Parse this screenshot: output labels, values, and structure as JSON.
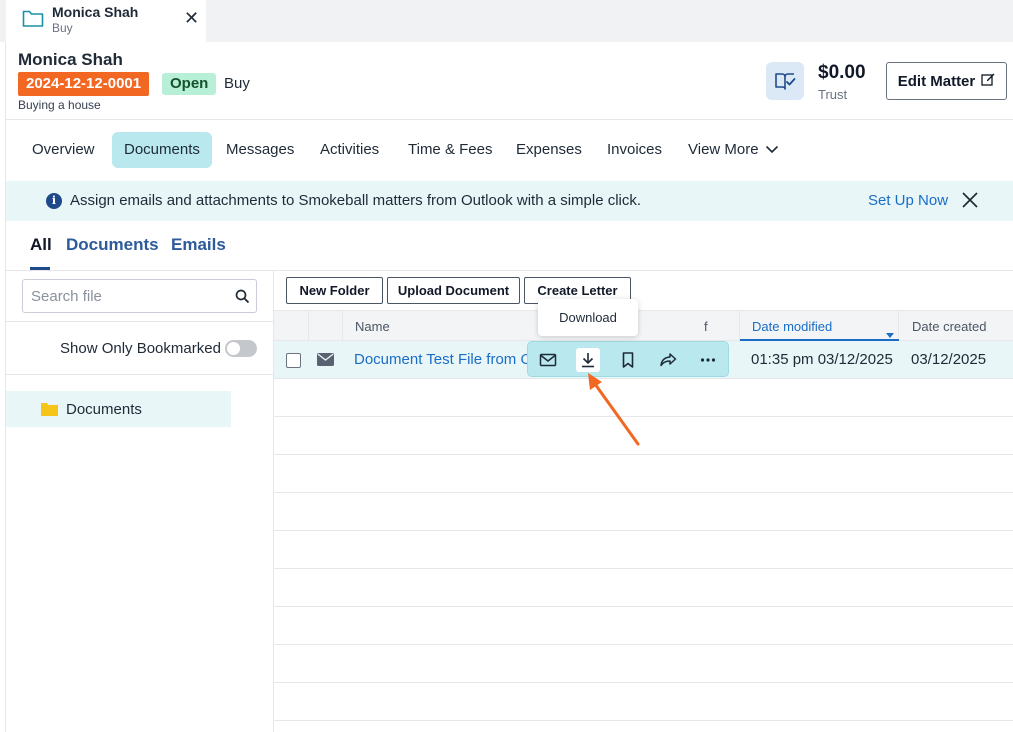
{
  "window_tab": {
    "title": "Monica Shah",
    "subtitle": "Buy",
    "close_glyph": "✕",
    "icon": "folder-icon"
  },
  "matter": {
    "client_name": "Monica Shah",
    "number": "2024-12-12-0001",
    "status": "Open",
    "type": "Buy",
    "description": "Buying a house",
    "trust_amount": "$0.00",
    "trust_label": "Trust",
    "edit_label": "Edit Matter"
  },
  "nav": {
    "tabs": [
      "Overview",
      "Documents",
      "Messages",
      "Activities",
      "Time & Fees",
      "Expenses",
      "Invoices",
      "View More"
    ],
    "active": "Documents"
  },
  "banner": {
    "message": "Assign emails and attachments to Smokeball matters from Outlook with a simple click.",
    "link": "Set Up Now",
    "info_glyph": "i"
  },
  "subtabs": {
    "items": [
      "All",
      "Documents",
      "Emails"
    ],
    "active": "All"
  },
  "sidebar": {
    "search_placeholder": "Search file",
    "bookmark_label": "Show Only Bookmarked",
    "bookmark_on": false,
    "folders": [
      "Documents"
    ]
  },
  "toolbar": {
    "new_folder": "New Folder",
    "upload": "Upload Document",
    "create_letter": "Create Letter"
  },
  "table": {
    "columns": {
      "name": "Name",
      "from": "f",
      "date_modified": "Date modified",
      "date_created": "Date created"
    },
    "rows": [
      {
        "name": "Document Test File from Outlook",
        "type_icon": "email-icon",
        "date_modified": "01:35 pm 03/12/2025",
        "date_created": "03/12/2025"
      }
    ]
  },
  "row_actions": {
    "items": [
      "mail-icon",
      "download-icon",
      "bookmark-icon",
      "share-icon",
      "more-icon"
    ],
    "tooltip": "Download"
  },
  "colors": {
    "accent": "#1a6dc7",
    "matter_badge": "#f26722",
    "status_badge": "#b7f0d7",
    "highlight": "#b9e8ee",
    "annotation_arrow": "#f26722"
  }
}
